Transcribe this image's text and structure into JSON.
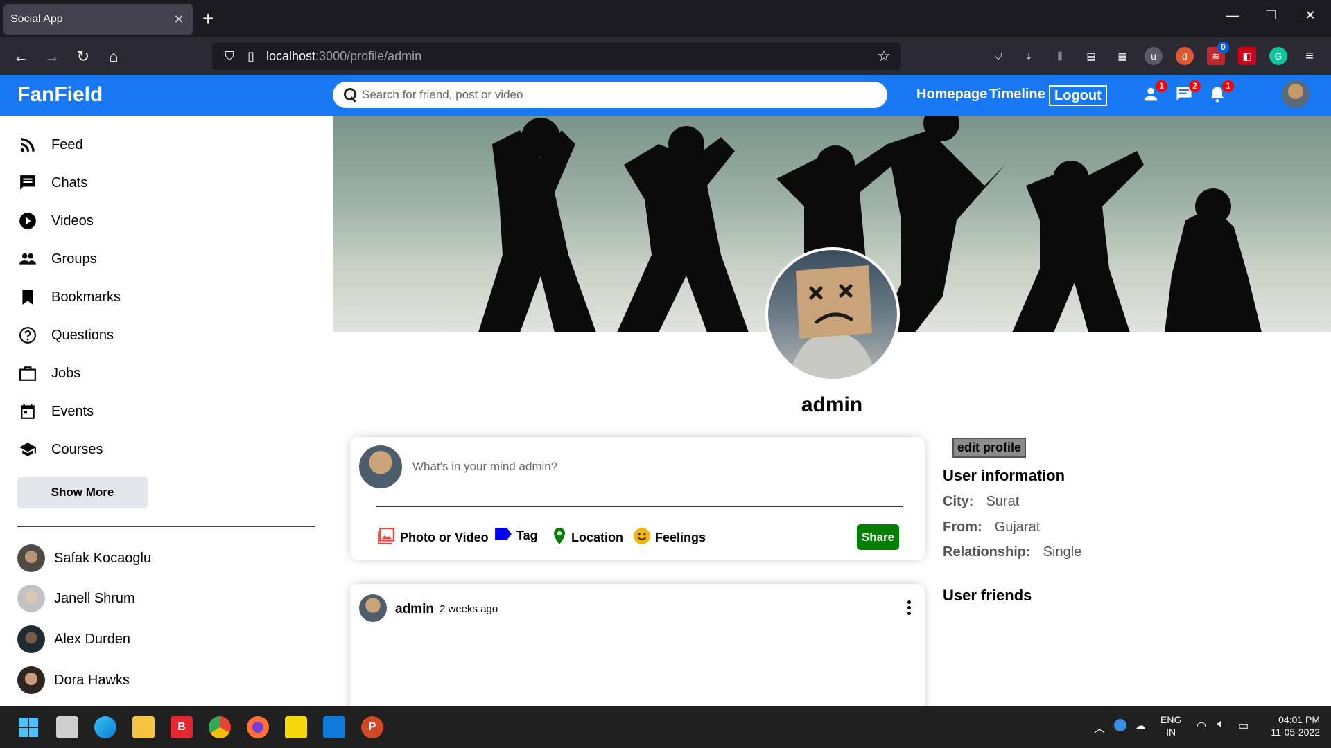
{
  "browser": {
    "tab_title": "Social App",
    "url_host": "localhost",
    "url_rest": ":3000/profile/admin",
    "ext_badge": "0"
  },
  "app": {
    "logo": "FanField",
    "search_placeholder": "Search for friend, post or video",
    "nav": {
      "homepage": "Homepage",
      "timeline": "Timeline",
      "logout": "Logout"
    },
    "badges": {
      "friends": "1",
      "messages": "2",
      "notifications": "1"
    }
  },
  "sidebar": {
    "items": [
      {
        "label": "Feed",
        "icon": "rss-icon"
      },
      {
        "label": "Chats",
        "icon": "chat-icon"
      },
      {
        "label": "Videos",
        "icon": "play-circle-icon"
      },
      {
        "label": "Groups",
        "icon": "group-icon"
      },
      {
        "label": "Bookmarks",
        "icon": "bookmark-icon"
      },
      {
        "label": "Questions",
        "icon": "help-circle-icon"
      },
      {
        "label": "Jobs",
        "icon": "briefcase-icon"
      },
      {
        "label": "Events",
        "icon": "calendar-icon"
      },
      {
        "label": "Courses",
        "icon": "school-icon"
      }
    ],
    "show_more": "Show More",
    "friends": [
      "Safak Kocaoglu",
      "Janell Shrum",
      "Alex Durden",
      "Dora Hawks"
    ]
  },
  "profile": {
    "name": "admin",
    "share": {
      "placeholder": "What's in your mind admin?",
      "options": [
        "Photo or Video",
        "Tag",
        "Location",
        "Feelings"
      ],
      "button": "Share"
    },
    "post": {
      "author": "admin",
      "time": "2 weeks ago"
    }
  },
  "rightbar": {
    "edit_button": "edit profile",
    "info_title": "User information",
    "info": [
      {
        "key": "City:",
        "value": "Surat"
      },
      {
        "key": "From:",
        "value": "Gujarat"
      },
      {
        "key": "Relationship:",
        "value": "Single"
      }
    ],
    "friends_title": "User friends"
  },
  "taskbar": {
    "lang_top": "ENG",
    "lang_bottom": "IN",
    "time": "04:01 PM",
    "date": "11-05-2022"
  },
  "colors": {
    "brand": "#1877f2",
    "share": "#008000",
    "badge": "#ff0000"
  }
}
